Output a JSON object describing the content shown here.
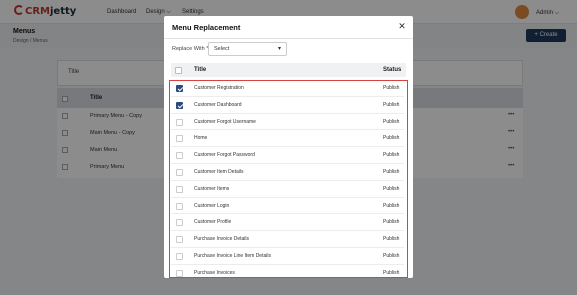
{
  "topbar": {
    "logo_crm": "CRM",
    "logo_jetty": "jetty",
    "nav": [
      "Dashboard",
      "Design ⌵",
      "Settings"
    ],
    "user": "Admin ⌵"
  },
  "page": {
    "title": "Menus",
    "breadcrumb": "Design  /  Menus",
    "create_label": "+  Create",
    "filter_label": "Title",
    "table_header": "Title",
    "rows": [
      "Primary Menu - Copy",
      "Main Menu - Copy",
      "Main Menu",
      "Primary Menu"
    ],
    "row_action": "•••"
  },
  "modal": {
    "title": "Menu Replacement",
    "close": "✕",
    "replace_with_label": "Replace With *",
    "select_value": "Select",
    "select_caret": "▾",
    "col_title": "Title",
    "col_status": "Status",
    "items": [
      {
        "title": "Customer Registration",
        "status": "Publish",
        "checked": true
      },
      {
        "title": "Customer Dashboard",
        "status": "Publish",
        "checked": true
      },
      {
        "title": "Customer Forgot Username",
        "status": "Publish",
        "checked": false
      },
      {
        "title": "Home",
        "status": "Publish",
        "checked": false
      },
      {
        "title": "Customer Forgot Password",
        "status": "Publish",
        "checked": false
      },
      {
        "title": "Customer Item Details",
        "status": "Publish",
        "checked": false
      },
      {
        "title": "Customer Items",
        "status": "Publish",
        "checked": false
      },
      {
        "title": "Customer Login",
        "status": "Publish",
        "checked": false
      },
      {
        "title": "Customer Profile",
        "status": "Publish",
        "checked": false
      },
      {
        "title": "Purchase Invoice Details",
        "status": "Publish",
        "checked": false
      },
      {
        "title": "Purchase Invoice Line Item Details",
        "status": "Publish",
        "checked": false
      },
      {
        "title": "Purchase Invoices",
        "status": "Publish",
        "checked": false
      }
    ]
  },
  "colors": {
    "accent": "#1f3a5c",
    "highlight_border": "#d94040",
    "checkbox_checked": "#2c4a7a"
  }
}
